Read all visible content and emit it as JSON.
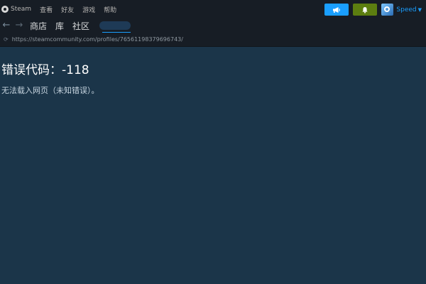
{
  "menu": {
    "steam": "Steam",
    "view": "查看",
    "friends": "好友",
    "games": "游戏",
    "help": "帮助"
  },
  "user": {
    "name": "Speed"
  },
  "nav": {
    "tabs": [
      "商店",
      "库",
      "社区"
    ]
  },
  "url": {
    "address": "https://steamcommunity.com/profiles/76561198379696743/"
  },
  "error": {
    "title": "错误代码：-118",
    "message": "无法载入网页（未知错误）。"
  },
  "colors": {
    "accent": "#1a9fff",
    "notify": "#5c7e10",
    "background": "#1b3549",
    "chrome": "#171d25"
  },
  "icons": {
    "announce": "megaphone-icon",
    "notify": "bell-icon",
    "back": "arrow-left-icon",
    "forward": "arrow-right-icon",
    "url": "loading-icon"
  }
}
